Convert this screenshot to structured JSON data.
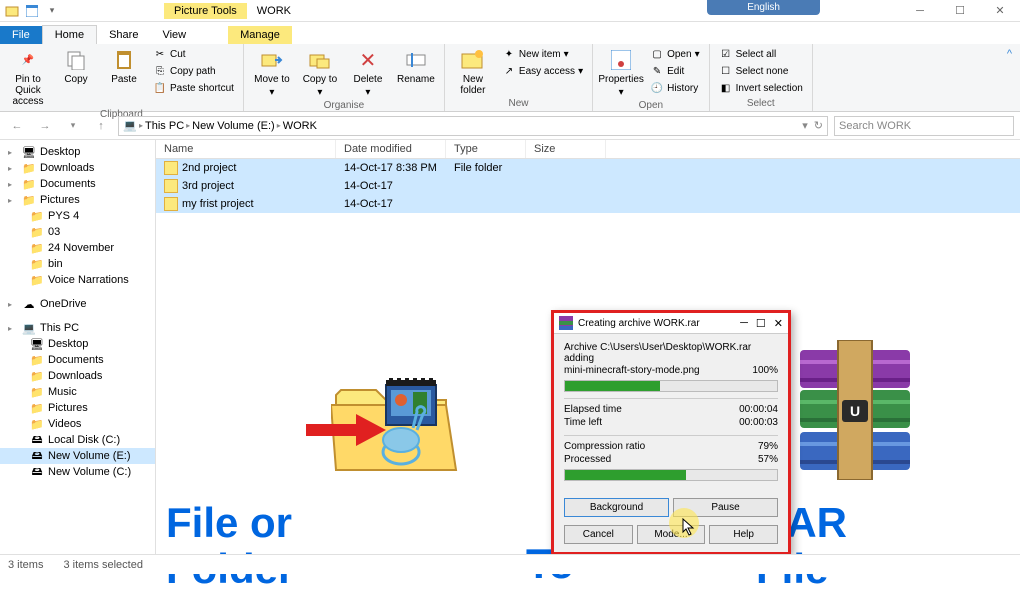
{
  "title_tabs": {
    "picture_tools": "Picture Tools",
    "work": "WORK"
  },
  "ribbon_tabs": {
    "file": "File",
    "home": "Home",
    "share": "Share",
    "view": "View",
    "manage": "Manage"
  },
  "ribbon": {
    "pin": "Pin to Quick access",
    "copy": "Copy",
    "paste": "Paste",
    "cut": "Cut",
    "copy_path": "Copy path",
    "paste_shortcut": "Paste shortcut",
    "clipboard": "Clipboard",
    "move_to": "Move to",
    "copy_to": "Copy to",
    "delete": "Delete",
    "rename": "Rename",
    "organise": "Organise",
    "new_folder": "New folder",
    "new_item": "New item",
    "easy_access": "Easy access",
    "new": "New",
    "properties": "Properties",
    "open": "Open",
    "edit": "Edit",
    "history": "History",
    "open_grp": "Open",
    "select_all": "Select all",
    "select_none": "Select none",
    "invert": "Invert selection",
    "select": "Select"
  },
  "breadcrumb": [
    "This PC",
    "New Volume (E:)",
    "WORK"
  ],
  "search_placeholder": "Search WORK",
  "language": "English",
  "columns": {
    "name": "Name",
    "date": "Date modified",
    "type": "Type",
    "size": "Size"
  },
  "sidebar": [
    {
      "label": "Desktop",
      "kind": "desktop",
      "l": 1
    },
    {
      "label": "Downloads",
      "kind": "folder",
      "l": 1
    },
    {
      "label": "Documents",
      "kind": "folder",
      "l": 1
    },
    {
      "label": "Pictures",
      "kind": "folder",
      "l": 1
    },
    {
      "label": "PYS 4",
      "kind": "folder",
      "l": 2
    },
    {
      "label": "03",
      "kind": "folder",
      "l": 2
    },
    {
      "label": "24 November",
      "kind": "folder",
      "l": 2
    },
    {
      "label": "bin",
      "kind": "folder",
      "l": 2
    },
    {
      "label": "Voice Narrations",
      "kind": "folder",
      "l": 2
    },
    {
      "label": "",
      "kind": "spacer"
    },
    {
      "label": "OneDrive",
      "kind": "onedrive",
      "l": 1
    },
    {
      "label": "",
      "kind": "spacer"
    },
    {
      "label": "This PC",
      "kind": "pc",
      "l": 1
    },
    {
      "label": "Desktop",
      "kind": "desktop",
      "l": 2
    },
    {
      "label": "Documents",
      "kind": "folder",
      "l": 2
    },
    {
      "label": "Downloads",
      "kind": "folder",
      "l": 2
    },
    {
      "label": "Music",
      "kind": "folder",
      "l": 2
    },
    {
      "label": "Pictures",
      "kind": "folder",
      "l": 2
    },
    {
      "label": "Videos",
      "kind": "folder",
      "l": 2
    },
    {
      "label": "Local Disk (C:)",
      "kind": "disk",
      "l": 2
    },
    {
      "label": "New Volume (E:)",
      "kind": "disk",
      "l": 2,
      "sel": true
    },
    {
      "label": "New Volume (C:)",
      "kind": "disk",
      "l": 2
    }
  ],
  "rows": [
    {
      "name": "2nd project",
      "date": "14-Oct-17 8:38 PM",
      "type": "File folder",
      "sel": true
    },
    {
      "name": "3rd project",
      "date": "14-Oct-17",
      "type": "",
      "sel": true
    },
    {
      "name": "my frist project",
      "date": "14-Oct-17",
      "type": "",
      "sel": true
    }
  ],
  "dialog": {
    "title": "Creating archive WORK.rar",
    "archive_label": "Archive C:\\Users\\User\\Desktop\\WORK.rar",
    "adding": "adding",
    "file": "mini-minecraft-story-mode.png",
    "file_pct": "100%",
    "elapsed_label": "Elapsed time",
    "elapsed": "00:00:04",
    "left_label": "Time left",
    "left": "00:00:03",
    "ratio_label": "Compression ratio",
    "ratio": "79%",
    "processed_label": "Processed",
    "processed": "57%",
    "btn_bg": "Background",
    "btn_pause": "Pause",
    "btn_cancel": "Cancel",
    "btn_mode": "Mode...",
    "btn_help": "Help"
  },
  "overlay": {
    "left": "File or\nFolder",
    "mid": "To",
    "right": "RAR\nFile"
  },
  "status": {
    "items": "3 items",
    "selected": "3 items selected"
  }
}
